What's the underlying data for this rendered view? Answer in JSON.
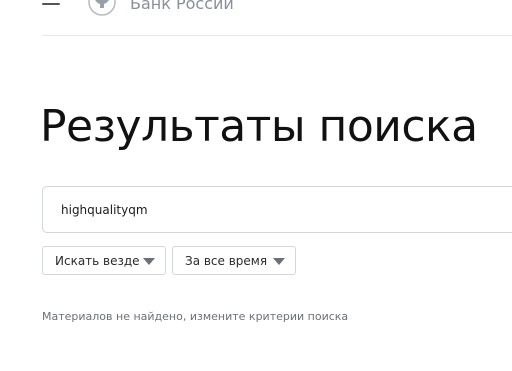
{
  "header": {
    "brand": "Банк России",
    "menu_icon": "hamburger-menu-icon",
    "logo_icon": "double-headed-eagle-icon"
  },
  "main": {
    "title": "Результаты поиска",
    "search": {
      "value": "highqualityqm",
      "placeholder": ""
    },
    "filters": [
      {
        "label": "Искать везде",
        "icon": "chevron-down-icon"
      },
      {
        "label": "За все время",
        "icon": "chevron-down-icon"
      }
    ],
    "status": "Материалов не найдено, измените критерии поиска"
  },
  "colors": {
    "title": "#111111",
    "muted_text": "#6b7079",
    "brand_text": "#8a8f99",
    "border": "#d3d6db"
  }
}
